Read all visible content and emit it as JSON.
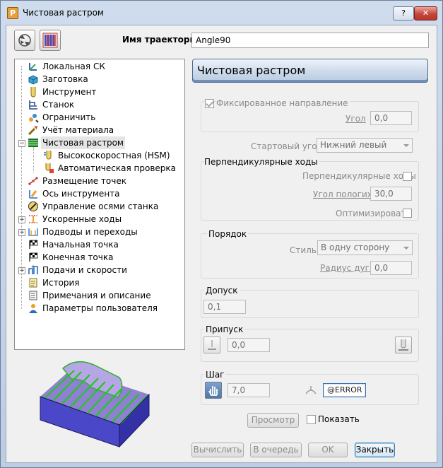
{
  "window": {
    "title": "Чистовая растром",
    "app_icon_letter": "P",
    "help_label": "?",
    "close_label": "✕"
  },
  "toolpath": {
    "name_label": "Имя траектории",
    "name_value": "Angle90"
  },
  "tree": {
    "items": [
      {
        "label": "Локальная СК",
        "icon": "workplane-icon"
      },
      {
        "label": "Заготовка",
        "icon": "block-icon"
      },
      {
        "label": "Инструмент",
        "icon": "tool-icon"
      },
      {
        "label": "Станок",
        "icon": "machine-icon"
      },
      {
        "label": "Ограничить",
        "icon": "limit-icon"
      },
      {
        "label": "Учёт материала",
        "icon": "rest-material-icon"
      },
      {
        "label": "Чистовая растром",
        "icon": "raster-finishing-icon"
      },
      {
        "label": "Высокоскоростная (HSM)",
        "icon": "high-speed-icon"
      },
      {
        "label": "Автоматическая проверка",
        "icon": "auto-verify-icon"
      },
      {
        "label": "Размещение точек",
        "icon": "point-distribution-icon"
      },
      {
        "label": "Ось инструмента",
        "icon": "tool-axis-icon"
      },
      {
        "label": "Управление осями станка",
        "icon": "axis-control-icon"
      },
      {
        "label": "Ускоренные ходы",
        "icon": "rapid-move-icon"
      },
      {
        "label": "Подводы и переходы",
        "icon": "leads-links-icon"
      },
      {
        "label": "Начальная точка",
        "icon": "start-point-icon"
      },
      {
        "label": "Конечная точка",
        "icon": "end-point-icon"
      },
      {
        "label": "Подачи и скорости",
        "icon": "feeds-speeds-icon"
      },
      {
        "label": "История",
        "icon": "history-icon"
      },
      {
        "label": "Примечания и описание",
        "icon": "notes-icon"
      },
      {
        "label": "Параметры пользователя",
        "icon": "user-params-icon"
      }
    ]
  },
  "panel": {
    "title": "Чистовая растром",
    "fixed_direction_label": "Фиксированное направление",
    "angle_label": "Угол",
    "angle_value": "0,0",
    "start_corner_label": "Стартовый угол",
    "start_corner_value": "Нижний левый",
    "perpendicular_group_label": "Перпендикулярные ходы",
    "perpendicular_check_label": "Перпендикулярные ходы",
    "shallow_angle_label": "Угол пологих",
    "shallow_angle_value": "30,0",
    "optimise_label": "Оптимизировать",
    "ordering_group_label": "Порядок",
    "style_label": "Стиль",
    "style_value": "В одну сторону",
    "arc_radius_label": "Радиус дуги",
    "arc_radius_value": "0,0",
    "tolerance_label": "Допуск",
    "tolerance_value": "0,1",
    "thickness_label": "Припуск",
    "thickness_value": "0,0",
    "stepover_label": "Шаг",
    "stepover_value": "7,0",
    "stepdown_value": "@ERROR",
    "preview_label": "Просмотр",
    "show_label": "Показать"
  },
  "buttons": {
    "calculate": "Вычислить",
    "queue": "В очередь",
    "ok": "OK",
    "close": "Закрыть"
  },
  "colors": {
    "header_accent": "#6f8fb8",
    "preview_stripe_green": "#22c722",
    "preview_stripe_purple": "#a58cd4",
    "preview_block": "#4a48c8"
  }
}
